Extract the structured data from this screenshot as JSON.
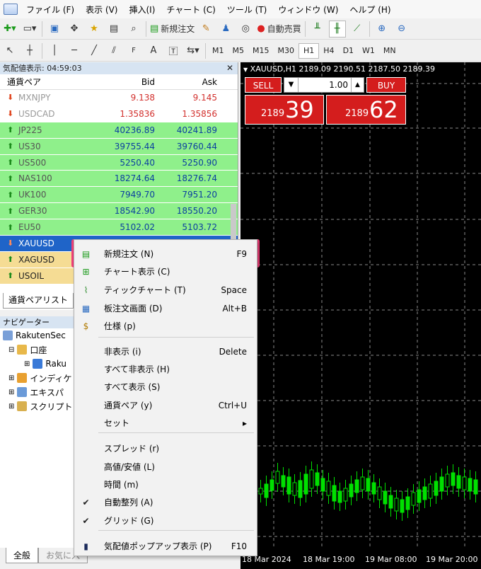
{
  "menubar": [
    "ファイル (F)",
    "表示 (V)",
    "挿入(I)",
    "チャート (C)",
    "ツール (T)",
    "ウィンドウ (W)",
    "ヘルプ (H)"
  ],
  "toolbar": {
    "new_order": "新規注文",
    "auto_trade": "自動売買"
  },
  "timeframes": [
    "M1",
    "M5",
    "M15",
    "M30",
    "H1",
    "H4",
    "D1",
    "W1",
    "MN"
  ],
  "market_watch": {
    "title": "気配値表示: 04:59:03",
    "col_pair": "通貨ペア",
    "col_bid": "Bid",
    "col_ask": "Ask",
    "tab": "通貨ペアリスト",
    "rows": [
      {
        "symbol": "MXNJPY",
        "bid": "9.138",
        "ask": "9.145",
        "dir": "down",
        "style": "dim"
      },
      {
        "symbol": "USDCAD",
        "bid": "1.35836",
        "ask": "1.35856",
        "dir": "down",
        "style": "dim"
      },
      {
        "symbol": "JP225",
        "bid": "40236.89",
        "ask": "40241.89",
        "dir": "up",
        "style": "green"
      },
      {
        "symbol": "US30",
        "bid": "39755.44",
        "ask": "39760.44",
        "dir": "up",
        "style": "green"
      },
      {
        "symbol": "US500",
        "bid": "5250.40",
        "ask": "5250.90",
        "dir": "up",
        "style": "green"
      },
      {
        "symbol": "NAS100",
        "bid": "18274.64",
        "ask": "18276.74",
        "dir": "up",
        "style": "green"
      },
      {
        "symbol": "UK100",
        "bid": "7949.70",
        "ask": "7951.20",
        "dir": "up",
        "style": "green"
      },
      {
        "symbol": "GER30",
        "bid": "18542.90",
        "ask": "18550.20",
        "dir": "up",
        "style": "green"
      },
      {
        "symbol": "EU50",
        "bid": "5102.02",
        "ask": "5103.72",
        "dir": "up",
        "style": "green"
      },
      {
        "symbol": "XAUUSD",
        "bid": "",
        "ask": "",
        "dir": "down",
        "style": "sel"
      },
      {
        "symbol": "XAGUSD",
        "bid": "",
        "ask": "",
        "dir": "up",
        "style": "yel"
      },
      {
        "symbol": "USOIL",
        "bid": "",
        "ask": "",
        "dir": "up",
        "style": "yel"
      }
    ]
  },
  "navigator": {
    "title": "ナビゲーター",
    "root": "RakutenSec",
    "account": "口座",
    "account_child": "Raku",
    "indicators": "インディケ",
    "experts": "エキスパ",
    "scripts": "スクリプト",
    "tab_all": "全般",
    "tab_fav": "お気に入"
  },
  "chart": {
    "title": "XAUUSD,H1  2189.09 2190.51 2187.50 2189.39",
    "sell_label": "SELL",
    "buy_label": "BUY",
    "lot": "1.00",
    "sell_small": "2189",
    "sell_big": "39",
    "buy_small": "2189",
    "buy_big": "62",
    "xlabels": [
      "18 Mar 2024",
      "18 Mar 19:00",
      "19 Mar 08:00",
      "19 Mar 20:00"
    ],
    "candle_color": "#00e000",
    "grid_color": "#8a8a8a"
  },
  "context_menu": {
    "items": [
      {
        "label": "新規注文 (N)",
        "shortcut": "F9",
        "icon": "new-order-icon"
      },
      {
        "label": "チャート表示 (C)",
        "shortcut": "",
        "icon": "chart-window-icon"
      },
      {
        "label": "ティックチャート (T)",
        "shortcut": "Space",
        "icon": "tick-chart-icon"
      },
      {
        "label": "板注文画面 (D)",
        "shortcut": "Alt+B",
        "icon": "depth-of-market-icon"
      },
      {
        "label": "仕様 (p)",
        "shortcut": "",
        "icon": "specification-icon"
      },
      {
        "label": "非表示 (i)",
        "shortcut": "Delete",
        "icon": ""
      },
      {
        "label": "すべて非表示 (H)",
        "shortcut": "",
        "icon": ""
      },
      {
        "label": "すべて表示 (S)",
        "shortcut": "",
        "icon": ""
      },
      {
        "label": "通貨ペア (y)",
        "shortcut": "Ctrl+U",
        "icon": ""
      },
      {
        "label": "セット",
        "shortcut": "▸",
        "icon": ""
      },
      {
        "label": "スプレッド (r)",
        "shortcut": "",
        "icon": ""
      },
      {
        "label": "高値/安値 (L)",
        "shortcut": "",
        "icon": ""
      },
      {
        "label": "時間 (m)",
        "shortcut": "",
        "icon": ""
      },
      {
        "label": "自動整列 (A)",
        "shortcut": "",
        "icon": "check-icon"
      },
      {
        "label": "グリッド (G)",
        "shortcut": "",
        "icon": "check-icon"
      },
      {
        "label": "気配値ポップアップ表示 (P)",
        "shortcut": "F10",
        "icon": "popup-prices-icon"
      }
    ]
  }
}
